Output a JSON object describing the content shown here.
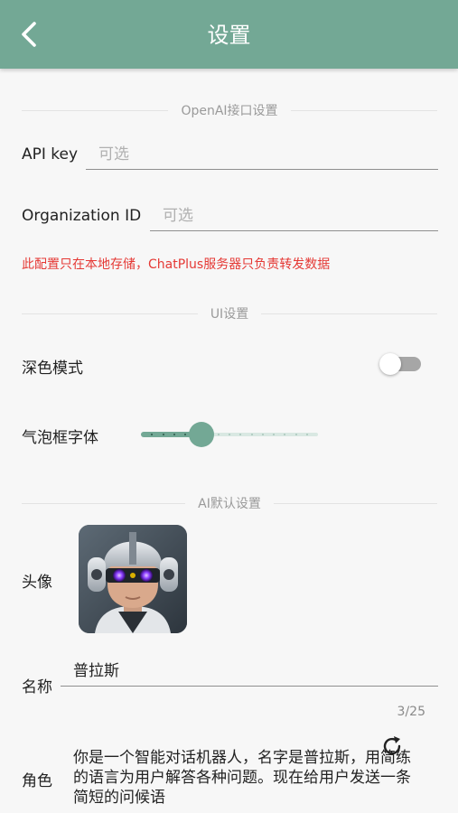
{
  "header": {
    "title": "设置",
    "back_icon": "chevron-left-icon",
    "color": "#73a895"
  },
  "openai_section": {
    "title": "OpenAI接口设置",
    "api_key_label": "API key",
    "api_key_placeholder": "可选",
    "org_id_label": "Organization ID",
    "org_id_placeholder": "可选",
    "warning": "此配置只在本地存储，ChatPlus服务器只负责转发数据",
    "warning_color": "#e53935"
  },
  "ui_section": {
    "title": "UI设置",
    "dark_mode_label": "深色模式",
    "dark_mode_on": false,
    "bubble_font_label": "气泡框字体",
    "bubble_font_level": 0.34
  },
  "ai_section": {
    "title": "AI默认设置",
    "avatar_label": "头像",
    "avatar_icon": "robot-avatar",
    "name_label": "名称",
    "name_value": "普拉斯",
    "name_counter": "3/25",
    "role_label": "角色",
    "role_value": "你是一个智能对话机器人，名字是普拉斯，用简练的语言为用户解答各种问题。现在给用户发送一条简短的问候语",
    "refresh_icon": "refresh-icon"
  }
}
